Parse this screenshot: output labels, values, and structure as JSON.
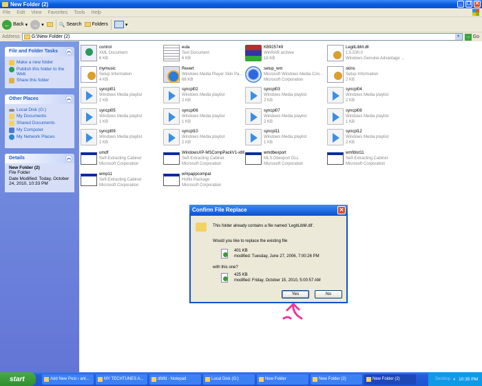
{
  "window": {
    "title": "New Folder (2)"
  },
  "menu": [
    "File",
    "Edit",
    "View",
    "Favorites",
    "Tools",
    "Help"
  ],
  "toolbar": {
    "back": "Back",
    "search": "Search",
    "folders": "Folders"
  },
  "address": {
    "label": "Address",
    "value": "G:\\New Folder (2)",
    "go": "Go"
  },
  "left_pane": {
    "tasks": {
      "title": "File and Folder Tasks",
      "items": [
        "Make a new folder",
        "Publish this folder to the Web",
        "Share this folder"
      ]
    },
    "places": {
      "title": "Other Places",
      "items": [
        "Local Disk (G:)",
        "My Documents",
        "Shared Documents",
        "My Computer",
        "My Network Places"
      ]
    },
    "details": {
      "title": "Details",
      "name": "New Folder (2)",
      "type": "File Folder",
      "modified": "Date Modified: Today, October 24, 2010, 10:33 PM"
    }
  },
  "files": [
    {
      "name": "control",
      "l1": "XML Document",
      "l2": "6 KB",
      "icon": "xml"
    },
    {
      "name": "eula",
      "l1": "Text Document",
      "l2": "6 KB",
      "icon": "txt"
    },
    {
      "name": "KB925749",
      "l1": "WinRAR archive",
      "l2": "18 KB",
      "icon": "rar"
    },
    {
      "name": "LegitLibM.dll",
      "l1": "1.5.530.0",
      "l2": "Windows Genuine Advantage ...",
      "icon": "dll"
    },
    {
      "name": "mymusic",
      "l1": "Setup Information",
      "l2": "4 KB",
      "icon": "inf"
    },
    {
      "name": "Revert",
      "l1": "Windows Media Player Skin Pa...",
      "l2": "66 KB",
      "icon": "skin"
    },
    {
      "name": "setup_wm",
      "l1": "Microsoft Windows Media Con...",
      "l2": "Microsoft Corporation",
      "icon": "wm"
    },
    {
      "name": "skins",
      "l1": "Setup Information",
      "l2": "2 KB",
      "icon": "inf"
    },
    {
      "name": "syncpl01",
      "l1": "Windows Media playlist",
      "l2": "2 KB",
      "icon": "play"
    },
    {
      "name": "syncpl02",
      "l1": "Windows Media playlist",
      "l2": "2 KB",
      "icon": "play"
    },
    {
      "name": "syncpl03",
      "l1": "Windows Media playlist",
      "l2": "2 KB",
      "icon": "play"
    },
    {
      "name": "syncpl04",
      "l1": "Windows Media playlist",
      "l2": "2 KB",
      "icon": "play"
    },
    {
      "name": "syncpl05",
      "l1": "Windows Media playlist",
      "l2": "1 KB",
      "icon": "play"
    },
    {
      "name": "syncpl06",
      "l1": "Windows Media playlist",
      "l2": "1 KB",
      "icon": "play"
    },
    {
      "name": "syncpl07",
      "l1": "Windows Media playlist",
      "l2": "2 KB",
      "icon": "play"
    },
    {
      "name": "syncpl08",
      "l1": "Windows Media playlist",
      "l2": "1 KB",
      "icon": "play"
    },
    {
      "name": "syncpl09",
      "l1": "Windows Media playlist",
      "l2": "2 KB",
      "icon": "play"
    },
    {
      "name": "syncpl10",
      "l1": "Windows Media playlist",
      "l2": "2 KB",
      "icon": "play"
    },
    {
      "name": "syncpl11",
      "l1": "Windows Media playlist",
      "l2": "1 KB",
      "icon": "play"
    },
    {
      "name": "syncpl12",
      "l1": "Windows Media playlist",
      "l2": "2 KB",
      "icon": "play"
    },
    {
      "name": "umdf",
      "l1": "Self-Extracting Cabinet",
      "l2": "Microsoft Corporation",
      "icon": "cab"
    },
    {
      "name": "WindowsXP-MSCompPackV1-x86",
      "l1": "Self-Extracting Cabinet",
      "l2": "Microsoft Corporation",
      "icon": "cab"
    },
    {
      "name": "wmdbexport",
      "l1": "MLS Dbexport DLL",
      "l2": "Microsoft Corporation",
      "icon": "cab"
    },
    {
      "name": "wmfdist11",
      "l1": "Self-Extracting Cabinet",
      "l2": "Microsoft Corporation",
      "icon": "cab"
    },
    {
      "name": "wmp11",
      "l1": "Self-Extracting Cabinet",
      "l2": "Microsoft Corporation",
      "icon": "cab"
    },
    {
      "name": "wmpappcompat",
      "l1": "Hotfix Package",
      "l2": "Microsoft Corporation",
      "icon": "cab"
    }
  ],
  "dialog": {
    "title": "Confirm File Replace",
    "message": "This folder already contains a file named 'LegitLibM.dll'.",
    "question": "Would you like to replace the existing file",
    "existing_size": "401 KB",
    "existing_modified": "modified: Tuesday, June 27, 2006, 7:00:26 PM",
    "with": "with this one?",
    "new_size": "425 KB",
    "new_modified": "modified: Friday, October 15, 2010, 5:00:57 AM",
    "yes": "Yes",
    "no": "No"
  },
  "taskbar": {
    "start": "start",
    "tasks": [
      "Add New Post ‹ ant...",
      "MY TECHTUNES A...",
      "dfdfd - Notepad",
      "Local Disk (G:)",
      "New Folder",
      "New Folder (2)",
      "New Folder (2)"
    ],
    "desktop": "Desktop",
    "clock": "10:35 PM"
  }
}
